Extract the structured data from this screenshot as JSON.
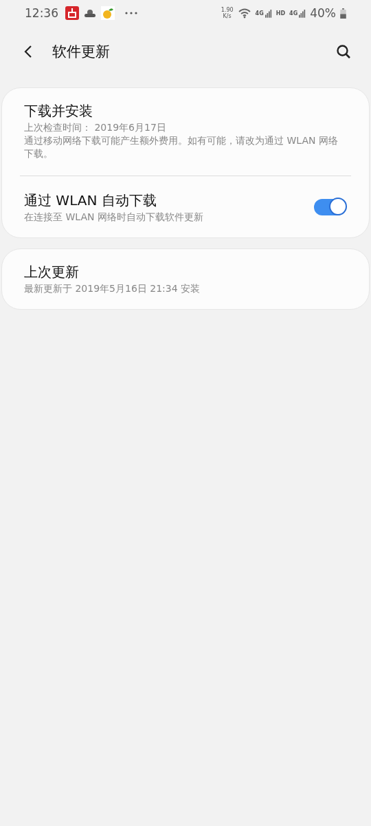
{
  "status_bar": {
    "time": "12:36",
    "net_speed": [
      "1.90",
      "K/s"
    ],
    "network_labels": [
      "4G",
      "HD",
      "4G"
    ],
    "battery": "40%"
  },
  "header": {
    "title": "软件更新"
  },
  "sections": [
    {
      "items": [
        {
          "kind": "info",
          "title": "下载并安装",
          "lines": [
            "上次检查时间： 2019年6月17日",
            "通过移动网络下载可能产生额外费用。如有可能，请改为通过 WLAN 网络下载。"
          ]
        },
        {
          "kind": "switch",
          "title": "通过 WLAN 自动下载",
          "lines": [
            "在连接至 WLAN 网络时自动下载软件更新"
          ],
          "on": true
        }
      ]
    },
    {
      "items": [
        {
          "kind": "info",
          "title": "上次更新",
          "lines": [
            "最新更新于 2019年5月16日 21:34 安装"
          ]
        }
      ]
    }
  ]
}
